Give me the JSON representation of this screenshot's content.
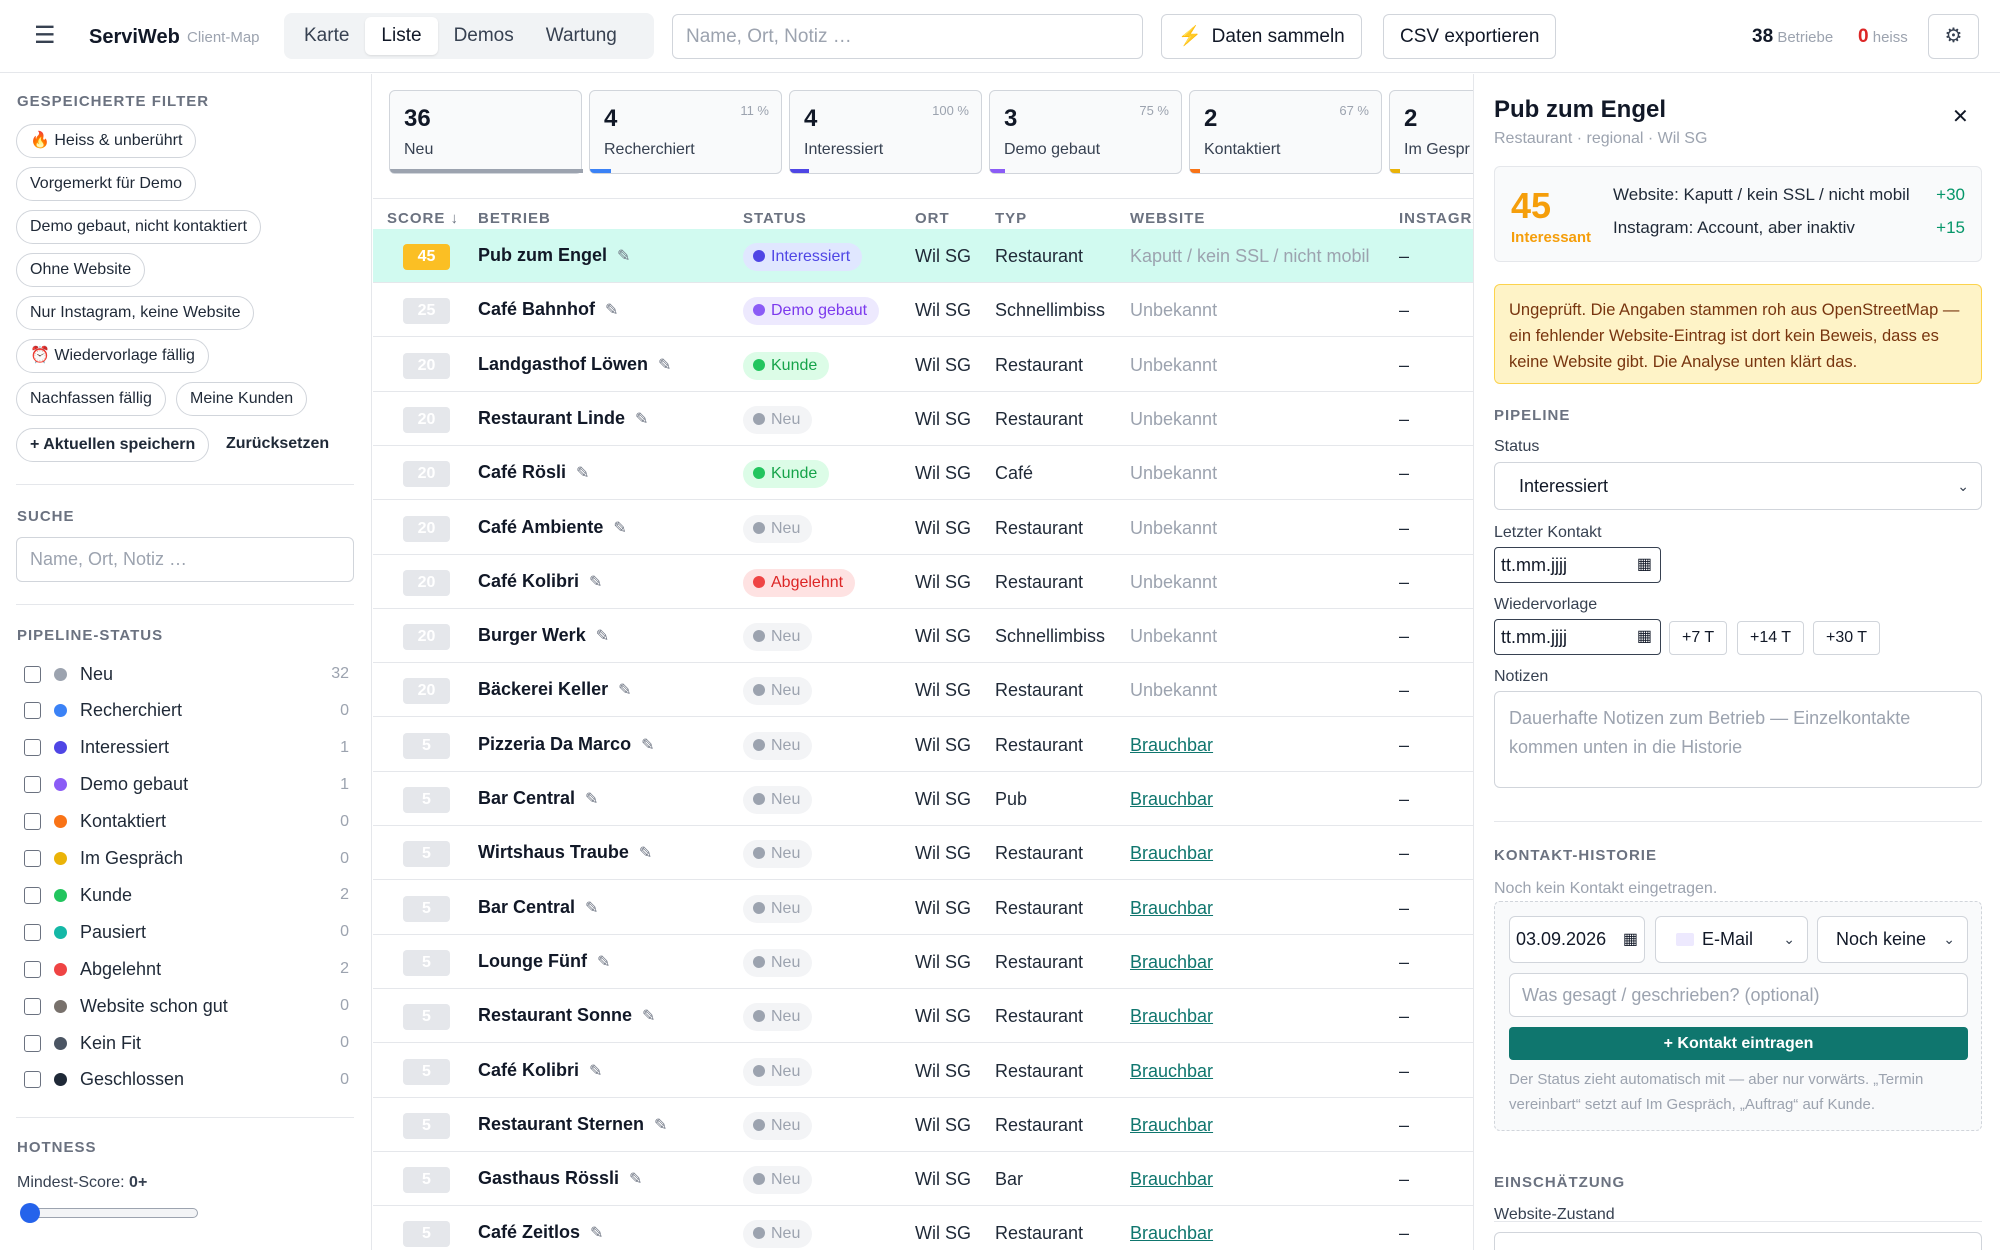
{
  "header": {
    "brand": "ServiWeb",
    "brand_sub": "Client-Map",
    "tabs": [
      "Karte",
      "Liste",
      "Demos",
      "Wartung"
    ],
    "active_tab": "Liste",
    "search_placeholder": "Name, Ort, Notiz …",
    "collect_button": "Daten sammeln",
    "export_button": "CSV exportieren",
    "count_total": "38",
    "count_total_label": "Betriebe",
    "count_hot": "0",
    "count_hot_label": "heiss"
  },
  "sidebar": {
    "saved_filters_title": "GESPEICHERTE FILTER",
    "saved_filters": [
      "Heiss & unberührt",
      "Vorgemerkt für Demo",
      "Demo gebaut, nicht kontaktiert",
      "Ohne Website",
      "Nur Instagram, keine Website",
      "Wiedervorlage fällig",
      "Nachfassen fällig",
      "Meine Kunden"
    ],
    "save_current": "+ Aktuellen speichern",
    "reset": "Zurücksetzen",
    "search_title": "SUCHE",
    "search_placeholder": "Name, Ort, Notiz …",
    "pipeline_title": "PIPELINE-STATUS",
    "pipeline": [
      {
        "label": "Neu",
        "count": "32",
        "color": "#9ca3af"
      },
      {
        "label": "Recherchiert",
        "count": "0",
        "color": "#3b82f6"
      },
      {
        "label": "Interessiert",
        "count": "1",
        "color": "#4f46e5"
      },
      {
        "label": "Demo gebaut",
        "count": "1",
        "color": "#8b5cf6"
      },
      {
        "label": "Kontaktiert",
        "count": "0",
        "color": "#f97316"
      },
      {
        "label": "Im Gespräch",
        "count": "0",
        "color": "#eab308"
      },
      {
        "label": "Kunde",
        "count": "2",
        "color": "#22c55e"
      },
      {
        "label": "Pausiert",
        "count": "0",
        "color": "#14b8a6"
      },
      {
        "label": "Abgelehnt",
        "count": "2",
        "color": "#ef4444"
      },
      {
        "label": "Website schon gut",
        "count": "0",
        "color": "#78716c"
      },
      {
        "label": "Kein Fit",
        "count": "0",
        "color": "#4b5563"
      },
      {
        "label": "Geschlossen",
        "count": "0",
        "color": "#1f2937"
      }
    ],
    "hotness_title": "HOTNESS",
    "min_score_label": "Mindest-Score:",
    "min_score_value": "0+"
  },
  "summary_cards": [
    {
      "num": "36",
      "label": "Neu",
      "pct": "",
      "color": "#9ca3af",
      "fill": 1.0
    },
    {
      "num": "4",
      "label": "Recherchiert",
      "pct": "11 %",
      "color": "#3b82f6",
      "fill": 0.11
    },
    {
      "num": "4",
      "label": "Interessiert",
      "pct": "100 %",
      "color": "#4f46e5",
      "fill": 0.1
    },
    {
      "num": "3",
      "label": "Demo gebaut",
      "pct": "75 %",
      "color": "#8b5cf6",
      "fill": 0.08
    },
    {
      "num": "2",
      "label": "Kontaktiert",
      "pct": "67 %",
      "color": "#f97316",
      "fill": 0.05
    },
    {
      "num": "2",
      "label": "Im Gespr",
      "pct": "",
      "color": "#eab308",
      "fill": 0.05
    }
  ],
  "table": {
    "columns": [
      "SCORE ↓",
      "BETRIEB",
      "STATUS",
      "ORT",
      "TYP",
      "WEBSITE",
      "INSTAGRA"
    ],
    "rows": [
      {
        "score": "45",
        "name": "Pub zum Engel",
        "status": "Interessiert",
        "ort": "Wil SG",
        "typ": "Restaurant",
        "website": "Kaputt / kein SSL / nicht mobil",
        "insta": "–"
      },
      {
        "score": "25",
        "name": "Café Bahnhof",
        "status": "Demo gebaut",
        "ort": "Wil SG",
        "typ": "Schnellimbiss",
        "website": "Unbekannt",
        "insta": "–"
      },
      {
        "score": "20",
        "name": "Landgasthof Löwen",
        "status": "Kunde",
        "ort": "Wil SG",
        "typ": "Restaurant",
        "website": "Unbekannt",
        "insta": "–"
      },
      {
        "score": "20",
        "name": "Restaurant Linde",
        "status": "Neu",
        "ort": "Wil SG",
        "typ": "Restaurant",
        "website": "Unbekannt",
        "insta": "–"
      },
      {
        "score": "20",
        "name": "Café Rösli",
        "status": "Kunde",
        "ort": "Wil SG",
        "typ": "Café",
        "website": "Unbekannt",
        "insta": "–"
      },
      {
        "score": "20",
        "name": "Café Ambiente",
        "status": "Neu",
        "ort": "Wil SG",
        "typ": "Restaurant",
        "website": "Unbekannt",
        "insta": "–"
      },
      {
        "score": "20",
        "name": "Café Kolibri",
        "status": "Abgelehnt",
        "ort": "Wil SG",
        "typ": "Restaurant",
        "website": "Unbekannt",
        "insta": "–"
      },
      {
        "score": "20",
        "name": "Burger Werk",
        "status": "Neu",
        "ort": "Wil SG",
        "typ": "Schnellimbiss",
        "website": "Unbekannt",
        "insta": "–"
      },
      {
        "score": "20",
        "name": "Bäckerei Keller",
        "status": "Neu",
        "ort": "Wil SG",
        "typ": "Restaurant",
        "website": "Unbekannt",
        "insta": "–"
      },
      {
        "score": "5",
        "name": "Pizzeria Da Marco",
        "status": "Neu",
        "ort": "Wil SG",
        "typ": "Restaurant",
        "website": "Brauchbar",
        "insta": "–"
      },
      {
        "score": "5",
        "name": "Bar Central",
        "status": "Neu",
        "ort": "Wil SG",
        "typ": "Pub",
        "website": "Brauchbar",
        "insta": "–"
      },
      {
        "score": "5",
        "name": "Wirtshaus Traube",
        "status": "Neu",
        "ort": "Wil SG",
        "typ": "Restaurant",
        "website": "Brauchbar",
        "insta": "–"
      },
      {
        "score": "5",
        "name": "Bar Central",
        "status": "Neu",
        "ort": "Wil SG",
        "typ": "Restaurant",
        "website": "Brauchbar",
        "insta": "–"
      },
      {
        "score": "5",
        "name": "Lounge Fünf",
        "status": "Neu",
        "ort": "Wil SG",
        "typ": "Restaurant",
        "website": "Brauchbar",
        "insta": "–"
      },
      {
        "score": "5",
        "name": "Restaurant Sonne",
        "status": "Neu",
        "ort": "Wil SG",
        "typ": "Restaurant",
        "website": "Brauchbar",
        "insta": "–"
      },
      {
        "score": "5",
        "name": "Café Kolibri",
        "status": "Neu",
        "ort": "Wil SG",
        "typ": "Restaurant",
        "website": "Brauchbar",
        "insta": "–"
      },
      {
        "score": "5",
        "name": "Restaurant Sternen",
        "status": "Neu",
        "ort": "Wil SG",
        "typ": "Restaurant",
        "website": "Brauchbar",
        "insta": "–"
      },
      {
        "score": "5",
        "name": "Gasthaus Rössli",
        "status": "Neu",
        "ort": "Wil SG",
        "typ": "Bar",
        "website": "Brauchbar",
        "insta": "–"
      },
      {
        "score": "5",
        "name": "Café Zeitlos",
        "status": "Neu",
        "ort": "Wil SG",
        "typ": "Restaurant",
        "website": "Brauchbar",
        "insta": "–"
      }
    ]
  },
  "status_styles": {
    "Interessiert": {
      "bg": "#e0e7ff",
      "fg": "#4f46e5",
      "dot": "#4f46e5"
    },
    "Demo gebaut": {
      "bg": "#ede9fe",
      "fg": "#7c3aed",
      "dot": "#8b5cf6"
    },
    "Kunde": {
      "bg": "#dcfce7",
      "fg": "#16a34a",
      "dot": "#22c55e"
    },
    "Neu": {
      "bg": "#f3f4f6",
      "fg": "#9ca3af",
      "dot": "#9ca3af"
    },
    "Abgelehnt": {
      "bg": "#fee2e2",
      "fg": "#dc2626",
      "dot": "#ef4444"
    }
  },
  "panel": {
    "title": "Pub zum Engel",
    "subtitle": "Restaurant · regional · Wil SG",
    "score": "45",
    "score_label": "Interessant",
    "reasons": [
      {
        "text": "Website: Kaputt / kein SSL / nicht mobil",
        "points": "+30"
      },
      {
        "text": "Instagram: Account, aber inaktiv",
        "points": "+15"
      }
    ],
    "warning": "Ungeprüft. Die Angaben stammen roh aus OpenStreetMap — ein fehlender Website-Eintrag ist dort kein Beweis, dass es keine Website gibt. Die Analyse unten klärt das.",
    "pipeline_title": "PIPELINE",
    "status_label": "Status",
    "status_value": "Interessiert",
    "last_contact_label": "Letzter Kontakt",
    "date_placeholder": "tt.mm.jjjj",
    "followup_label": "Wiedervorlage",
    "quick_buttons": [
      "+7 T",
      "+14 T",
      "+30 T"
    ],
    "notes_label": "Notizen",
    "notes_placeholder": "Dauerhafte Notizen zum Betrieb — Einzelkontakte kommen unten in die Historie",
    "history_title": "KONTAKT-HISTORIE",
    "history_empty": "Noch kein Kontakt eingetragen.",
    "history_date": "03.09.2026",
    "history_channel": "E-Mail",
    "history_result": "Noch keine",
    "history_text_placeholder": "Was gesagt / geschrieben? (optional)",
    "history_submit": "+ Kontakt eintragen",
    "history_hint": "Der Status zieht automatisch mit — aber nur vorwärts. „Termin vereinbart“ setzt auf Im Gespräch, „Auftrag“ auf Kunde.",
    "assessment_title": "EINSCHÄTZUNG",
    "website_state_label": "Website-Zustand"
  }
}
